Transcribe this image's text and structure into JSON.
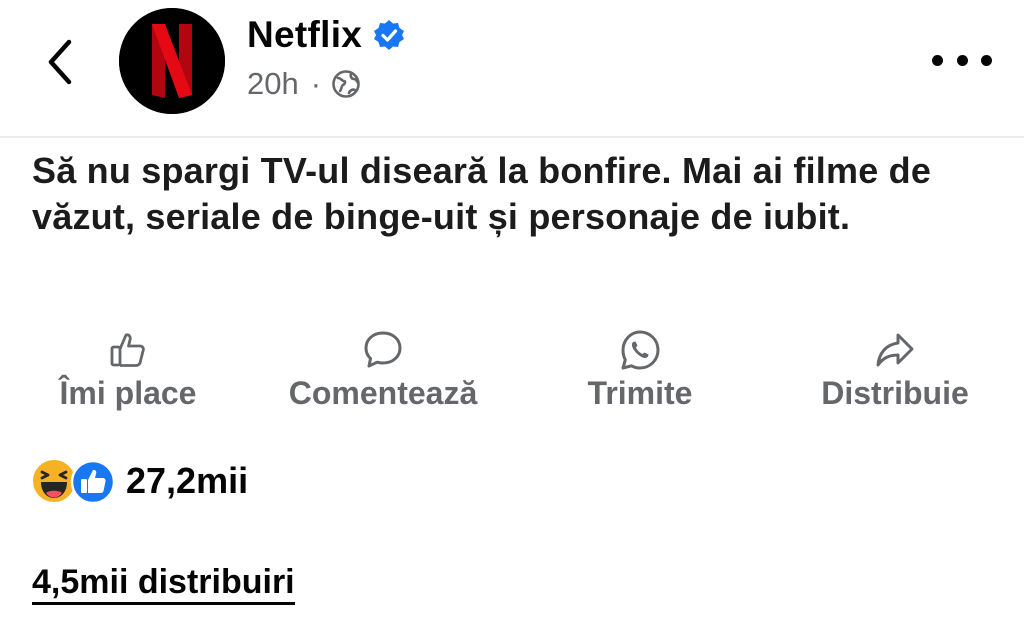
{
  "header": {
    "page_name": "Netflix",
    "time_ago": "20h",
    "separator": "·",
    "audience_icon": "globe-icon",
    "verified_icon": "verified-badge-icon",
    "back_icon": "chevron-left-icon",
    "more_icon": "more-horizontal-icon",
    "avatar_letter": "N"
  },
  "post": {
    "text": "Să nu spargi TV-ul diseară la bonfire. Mai ai filme de văzut, seriale de binge-uit și personaje de iubit."
  },
  "actions": [
    {
      "label": "Îmi place",
      "icon": "thumbs-up-icon"
    },
    {
      "label": "Comentează",
      "icon": "comment-icon"
    },
    {
      "label": "Trimite",
      "icon": "whatsapp-icon"
    },
    {
      "label": "Distribuie",
      "icon": "share-arrow-icon"
    }
  ],
  "reactions": {
    "count": "27,2mii",
    "icons": [
      "haha-reaction-icon",
      "like-reaction-icon"
    ]
  },
  "shares": {
    "label": "4,5mii distribuiri"
  },
  "colors": {
    "text": "#050505",
    "secondary": "#65676b",
    "verified": "#1877f2",
    "netflix_red": "#e50914",
    "avatar_bg": "#000000",
    "haha_yellow": "#f7b125"
  }
}
